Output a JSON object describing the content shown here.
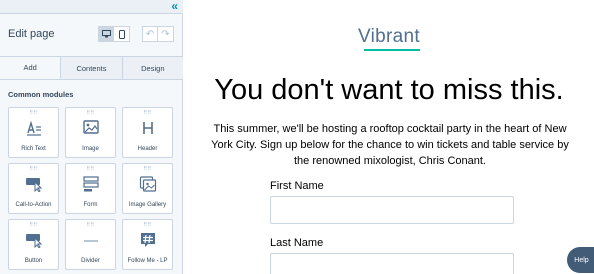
{
  "sidebar": {
    "collapse_icon": "double-chevron-left-icon",
    "title": "Edit page",
    "view_buttons": [
      {
        "name": "desktop-icon",
        "active": true
      },
      {
        "name": "mobile-icon",
        "active": false
      }
    ],
    "history_buttons": [
      {
        "name": "undo-icon",
        "glyph": "↶"
      },
      {
        "name": "redo-icon",
        "glyph": "↷"
      }
    ],
    "tabs": [
      {
        "label": "Add",
        "active": true
      },
      {
        "label": "Contents",
        "active": false
      },
      {
        "label": "Design",
        "active": false
      }
    ],
    "section_title": "Common modules",
    "modules": [
      {
        "label": "Rich Text",
        "icon": "rich-text-icon"
      },
      {
        "label": "Image",
        "icon": "image-icon"
      },
      {
        "label": "Header",
        "icon": "header-icon"
      },
      {
        "label": "Call-to-Action",
        "icon": "call-to-action-icon"
      },
      {
        "label": "Form",
        "icon": "form-icon"
      },
      {
        "label": "Image Gallery",
        "icon": "image-gallery-icon"
      },
      {
        "label": "Button",
        "icon": "button-icon"
      },
      {
        "label": "Divider",
        "icon": "divider-icon"
      },
      {
        "label": "Follow Me - LP",
        "icon": "hashtag-icon"
      }
    ]
  },
  "page": {
    "logo": "Vibrant",
    "headline": "You don't want to miss this.",
    "body": "This summer, we'll be hosting a rooftop cocktail party in the heart of New York City. Sign up below for the chance to win tickets and table service by the renowned mixologist, Chris Conant.",
    "form": {
      "first_name_label": "First Name",
      "last_name_label": "Last Name"
    }
  },
  "help": {
    "label": "Help"
  },
  "colors": {
    "accent": "#0091ae",
    "logo_underline": "#00bda5",
    "help_button": "#425b76"
  }
}
